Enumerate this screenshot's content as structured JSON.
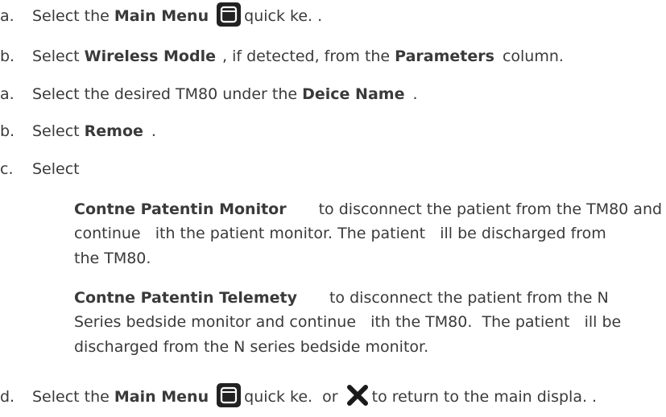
{
  "step_a1": {
    "marker": "a.",
    "pre": "Select the ",
    "bold": "Main Menu",
    "post": "quick ke. ."
  },
  "step_b1": {
    "marker": "b.",
    "pre": "Select ",
    "bold1": "Wireless Modle",
    "mid": ", if detected, from the ",
    "bold2": "Parameters",
    "post": "column."
  },
  "step_a2": {
    "marker": "a.",
    "pre": "Select the desired TM80 under the ",
    "bold": "Deice Name",
    "post": "."
  },
  "step_b2": {
    "marker": "b.",
    "pre": "Select ",
    "bold": "Remoe",
    "post": "."
  },
  "step_c": {
    "marker": "c.",
    "text": "Select"
  },
  "option1": {
    "bold": "Contne Patentin Monitor",
    "line1": "to disconnect the patient from the TM80 and",
    "line2": "continue   ith the patient monitor. The patient   ill be discharged from",
    "line3": "the TM80."
  },
  "option2": {
    "bold": "Contne Patentin Telemety",
    "line1": "to disconnect the patient from the N",
    "line2": "Series bedside monitor and continue   ith the TM80.  The patient   ill be",
    "line3": "discharged from the N series bedside monitor."
  },
  "step_d": {
    "marker": "d.",
    "pre": "Select the ",
    "bold": "Main Menu",
    "mid": "quick ke.  or",
    "post": "to return to the main displa. ."
  },
  "icons": {
    "main_menu": "main-menu-icon",
    "close": "close-x-icon"
  },
  "colors": {
    "text": "#3a3a3a",
    "icon_bg": "#222222"
  }
}
